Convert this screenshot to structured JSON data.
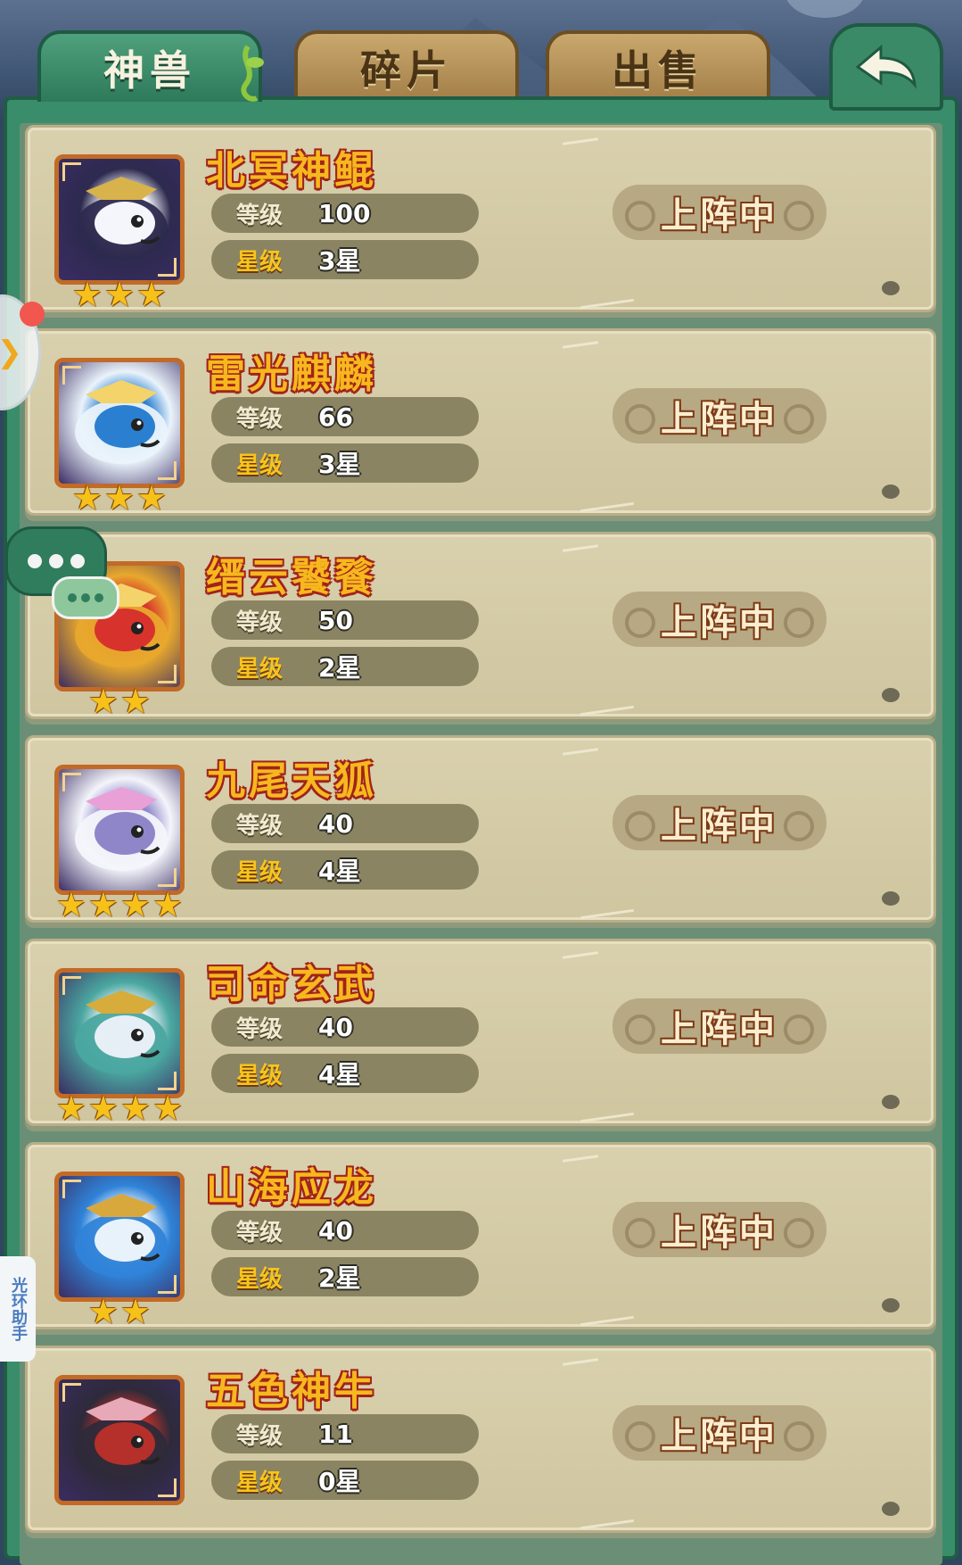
{
  "tabs": [
    {
      "label": "神兽",
      "active": true
    },
    {
      "label": "碎片",
      "active": false
    },
    {
      "label": "出售",
      "active": false
    }
  ],
  "labels": {
    "level": "等级",
    "star": "星级",
    "deploy": "上阵中"
  },
  "assistant": "光环助手",
  "beasts": [
    {
      "name": "北冥神鲲",
      "level": "100",
      "star": "3星",
      "stars": 3,
      "colors": [
        "#2d2a4f",
        "#f4f6fb",
        "#d8b24a"
      ]
    },
    {
      "name": "雷光麒麟",
      "level": "66",
      "star": "3星",
      "stars": 3,
      "colors": [
        "#eaf3fb",
        "#2a7fd0",
        "#f3d36a"
      ]
    },
    {
      "name": "缙云饕餮",
      "level": "50",
      "star": "2星",
      "stars": 2,
      "colors": [
        "#e8a82d",
        "#d8322c",
        "#f5d36b"
      ]
    },
    {
      "name": "九尾天狐",
      "level": "40",
      "star": "4星",
      "stars": 4,
      "colors": [
        "#f4f5fb",
        "#8f86c9",
        "#e9a0d6"
      ]
    },
    {
      "name": "司命玄武",
      "level": "40",
      "star": "4星",
      "stars": 4,
      "colors": [
        "#4aa7a0",
        "#e6eef6",
        "#d7ac3a"
      ]
    },
    {
      "name": "山海应龙",
      "level": "40",
      "star": "2星",
      "stars": 2,
      "colors": [
        "#2f83d8",
        "#e8f2fb",
        "#d9a83d"
      ]
    },
    {
      "name": "五色神牛",
      "level": "11",
      "star": "0星",
      "stars": 0,
      "colors": [
        "#2e2a3a",
        "#b5302a",
        "#e7a8b8"
      ]
    }
  ]
}
